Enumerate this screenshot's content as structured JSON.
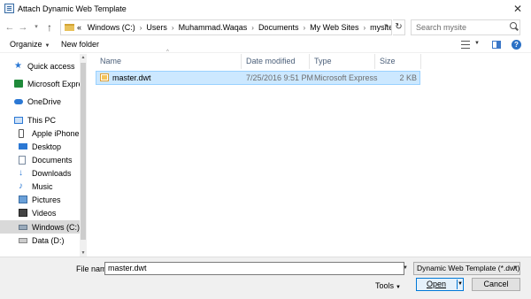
{
  "window": {
    "title": "Attach Dynamic Web Template",
    "close_glyph": "✕"
  },
  "nav": {
    "back": "←",
    "forward": "→",
    "recent": "▾",
    "up": "↑"
  },
  "address": {
    "prefix": "«",
    "crumbs": [
      "Windows (C:)",
      "Users",
      "Muhammad.Waqas",
      "Documents",
      "My Web Sites",
      "mysite"
    ],
    "separator": "›",
    "dropdown": "▾",
    "refresh": "↻"
  },
  "search": {
    "placeholder": "Search mysite"
  },
  "toolbar": {
    "organize": "Organize",
    "new_folder": "New folder",
    "dropdown": "▼",
    "help": "?"
  },
  "sidebar": {
    "items": [
      {
        "label": "Quick access",
        "icon": "star-icon"
      },
      {
        "label": "Microsoft Expressi",
        "icon": "expression-web-icon"
      },
      {
        "label": "OneDrive",
        "icon": "cloud-icon"
      },
      {
        "label": "This PC",
        "icon": "computer-icon"
      },
      {
        "label": "Apple iPhone",
        "icon": "phone-icon"
      },
      {
        "label": "Desktop",
        "icon": "desktop-icon"
      },
      {
        "label": "Documents",
        "icon": "documents-icon"
      },
      {
        "label": "Downloads",
        "icon": "download-icon"
      },
      {
        "label": "Music",
        "icon": "music-icon"
      },
      {
        "label": "Pictures",
        "icon": "pictures-icon"
      },
      {
        "label": "Videos",
        "icon": "videos-icon"
      },
      {
        "label": "Windows (C:)",
        "icon": "drive-icon"
      },
      {
        "label": "Data (D:)",
        "icon": "drive-icon"
      }
    ],
    "selected": "Windows (C:)",
    "scroll_up": "▲",
    "scroll_down": "▼"
  },
  "list": {
    "columns": [
      "Name",
      "Date modified",
      "Type",
      "Size"
    ],
    "sort_glyph": "^",
    "rows": [
      {
        "name": "master.dwt",
        "date": "7/25/2016 9:51 PM",
        "type": "Microsoft Expressi...",
        "size": "2 KB",
        "selected": true
      }
    ]
  },
  "bottom": {
    "file_name_label": "File name:",
    "file_name_value": "master.dwt",
    "filter": "Dynamic Web Template (*.dwt)",
    "tools": "Tools",
    "open": "Open",
    "cancel": "Cancel",
    "dropdown": "▼"
  },
  "colors": {
    "selection_bg": "#cce8ff",
    "selection_border": "#99d1ff",
    "accent": "#0078d7"
  }
}
